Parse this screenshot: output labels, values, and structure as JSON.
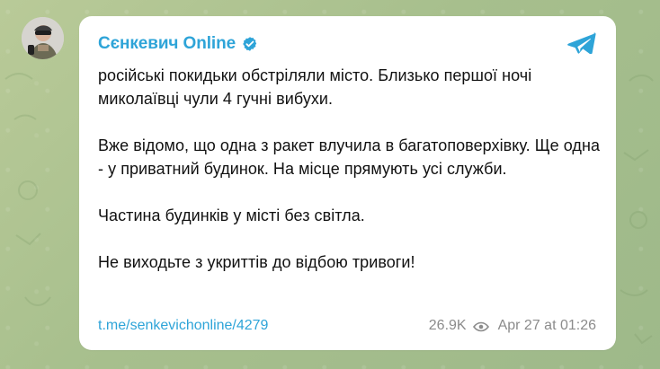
{
  "channel": {
    "name": "Сєнкевич Online",
    "avatar_icon": "channel-avatar",
    "verified_icon": "verified-icon",
    "platform_icon": "telegram-icon"
  },
  "message": {
    "text": "російські покидьки обстріляли місто. Близько першої ночі миколаївці чули 4 гучні вибухи.\n\nВже відомо, що одна з ракет влучила в багатоповерхівку. Ще одна - у приватний будинок. На місце прямують усі служби.\n\nЧастина будинків у місті без світла.\n\nНе виходьте з укриттів до відбою тривоги!"
  },
  "footer": {
    "link_text": "t.me/senkevichonline/4279",
    "views": "26.9K",
    "views_icon": "eye-icon",
    "timestamp": "Apr 27 at 01:26"
  },
  "colors": {
    "accent": "#2ea4d8",
    "background": "#a9bf8e",
    "card": "#ffffff",
    "muted_text": "#8b8b8b",
    "body_text": "#111111"
  }
}
